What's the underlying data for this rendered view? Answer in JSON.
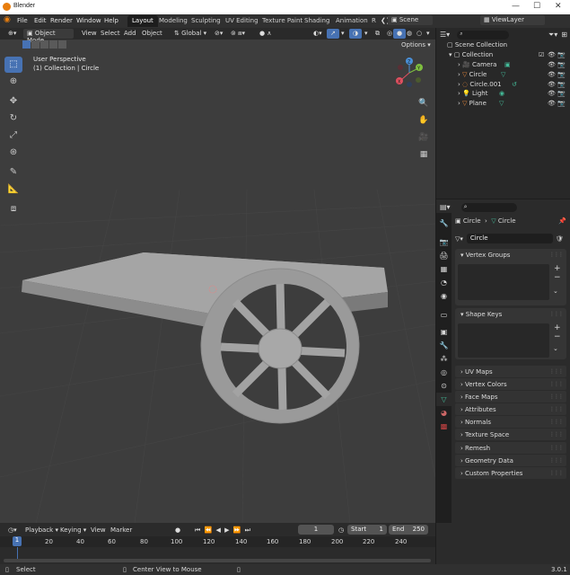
{
  "window": {
    "title": "Blender"
  },
  "menus": [
    "File",
    "Edit",
    "Render",
    "Window",
    "Help"
  ],
  "workspaces": [
    "Layout",
    "Modeling",
    "Sculpting",
    "UV Editing",
    "Texture Paint",
    "Shading",
    "Animation",
    "R"
  ],
  "scene": {
    "label": "Scene",
    "view_layer": "ViewLayer"
  },
  "viewport_header": {
    "mode": "Object Mode",
    "view": "View",
    "select": "Select",
    "add": "Add",
    "object": "Object",
    "orientation": "Global",
    "options": "Options"
  },
  "viewport": {
    "perspective": "User Perspective",
    "collection_info": "(1) Collection | Circle",
    "gizmo_axes": {
      "z": "Z",
      "y": "Y",
      "x": "X"
    }
  },
  "outliner": {
    "scene_collection": "Scene Collection",
    "collection": "Collection",
    "items": [
      {
        "name": "Camera",
        "icon": "camera-icon",
        "color": "#e8873a"
      },
      {
        "name": "Circle",
        "icon": "mesh-icon",
        "color": "#e8873a"
      },
      {
        "name": "Circle.001",
        "icon": "curve-icon",
        "color": "#e8873a"
      },
      {
        "name": "Light",
        "icon": "light-icon",
        "color": "#e8873a"
      },
      {
        "name": "Plane",
        "icon": "mesh-icon",
        "color": "#e8873a"
      }
    ]
  },
  "properties": {
    "breadcrumb_obj": "Circle",
    "breadcrumb_data": "Circle",
    "mesh_name": "Circle",
    "panels": {
      "vertex_groups": "Vertex Groups",
      "shape_keys": "Shape Keys"
    },
    "collapsed": [
      "UV Maps",
      "Vertex Colors",
      "Face Maps",
      "Attributes",
      "Normals",
      "Texture Space",
      "Remesh",
      "Geometry Data",
      "Custom Properties"
    ]
  },
  "timeline": {
    "playback": "Playback",
    "keying": "Keying",
    "view": "View",
    "marker": "Marker",
    "current_frame": "1",
    "start_label": "Start",
    "start": "1",
    "end_label": "End",
    "end": "250",
    "ticks": [
      "1",
      "20",
      "40",
      "60",
      "80",
      "100",
      "120",
      "140",
      "160",
      "180",
      "200",
      "220",
      "240"
    ]
  },
  "status": {
    "select": "Select",
    "center": "Center View to Mouse",
    "version": "3.0.1"
  },
  "colors": {
    "accent": "#4772b3",
    "viewport_bg": "#3d3d3d",
    "object_orange": "#e8873a",
    "active_blue": "#4772b3"
  }
}
